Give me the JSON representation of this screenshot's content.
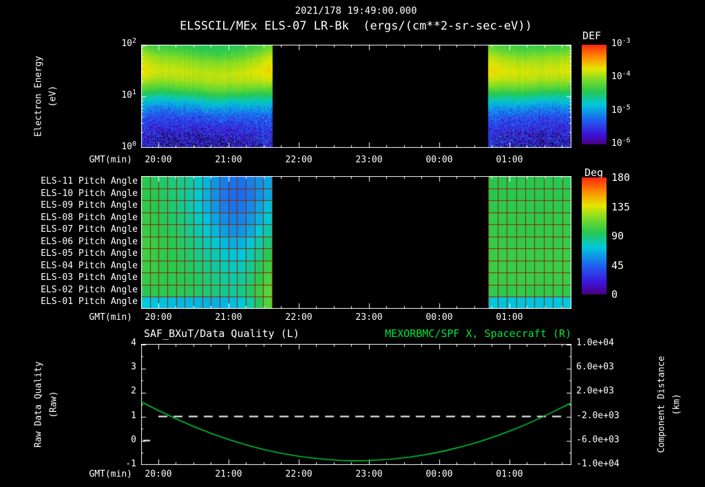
{
  "header": {
    "timestamp": "2021/178 19:49:00.000",
    "title": "ELSSCIL/MEx ELS-07 LR-Bk  (ergs/(cm**2-sr-sec-eV))"
  },
  "time_axis": {
    "label": "GMT(min)",
    "tick_labels": [
      "20:00",
      "21:00",
      "22:00",
      "23:00",
      "00:00",
      "01:00"
    ],
    "tick_minutes": [
      0,
      60,
      120,
      180,
      240,
      300
    ],
    "start_min": -14.7,
    "end_min": 353
  },
  "spectrogram_panel": {
    "ylabel": "Electron Energy",
    "ylabel_units": "(eV)",
    "ytick_base": "10",
    "ytick_exps": [
      "2",
      "1",
      "0"
    ],
    "colorbar_label": "DEF",
    "colorbar_tick_base": "10",
    "colorbar_tick_exps": [
      "-3",
      "-4",
      "-5",
      "-6"
    ]
  },
  "pitch_panel": {
    "row_labels": [
      "ELS-11 Pitch Angle",
      "ELS-10 Pitch Angle",
      "ELS-09 Pitch Angle",
      "ELS-08 Pitch Angle",
      "ELS-07 Pitch Angle",
      "ELS-06 Pitch Angle",
      "ELS-05 Pitch Angle",
      "ELS-04 Pitch Angle",
      "ELS-03 Pitch Angle",
      "ELS-02 Pitch Angle",
      "ELS-01 Pitch Angle"
    ],
    "colorbar_label": "Deg",
    "colorbar_ticks": [
      "180",
      "135",
      "90",
      "45",
      "0"
    ]
  },
  "line_panel": {
    "left_title": "SAF_BXuT/Data Quality (L)",
    "right_title": "MEXORBMC/SPF X, Spacecraft (R)",
    "left_axis_label": "Raw Data Quality",
    "left_axis_units": "(Raw)",
    "left_ticks": [
      "4",
      "3",
      "2",
      "1",
      "0",
      "-1"
    ],
    "right_axis_label": "Component Distance",
    "right_axis_units": "(km)",
    "right_ticks": [
      "1.0e+04",
      "6.0e+03",
      "2.0e+03",
      "-2.0e+03",
      "-6.0e+03",
      "-1.0e+04"
    ]
  },
  "colors": {
    "background": "#000000",
    "foreground": "#ffffff",
    "green_text": "#00e63c",
    "curve_green": "#00c838",
    "quality_line": "#ffffff",
    "grid_red": "#8a2600"
  },
  "colormap": [
    [
      0.0,
      "#4b0082"
    ],
    [
      0.1,
      "#3c14dc"
    ],
    [
      0.25,
      "#1e64f0"
    ],
    [
      0.4,
      "#00c8dc"
    ],
    [
      0.53,
      "#28c850"
    ],
    [
      0.65,
      "#7ddc28"
    ],
    [
      0.76,
      "#e6e600"
    ],
    [
      0.88,
      "#ff8c00"
    ],
    [
      1.0,
      "#ff2814"
    ]
  ],
  "chart_data": [
    {
      "type": "heatmap",
      "name": "electron-energy-spectrogram",
      "title": "ELSSCIL/MEx ELS-07 LR-Bk",
      "units": "DEF ergs/(cm**2-sr-sec-eV)",
      "ylabel": "Electron Energy (eV)",
      "y_log10_range": [
        0,
        2
      ],
      "value_log10_range": [
        -6,
        -3
      ],
      "time_segments_min": [
        [
          -14.7,
          97
        ],
        [
          282,
          353
        ]
      ],
      "reference_profile": [
        [
          0.0,
          -5.78
        ],
        [
          0.25,
          -5.7
        ],
        [
          0.5,
          -5.5
        ],
        [
          0.7,
          -5.2
        ],
        [
          0.85,
          -4.9
        ],
        [
          1.0,
          -4.55
        ],
        [
          1.15,
          -4.2
        ],
        [
          1.3,
          -3.95
        ],
        [
          1.45,
          -3.85
        ],
        [
          1.55,
          -3.92
        ],
        [
          1.7,
          -4.05
        ],
        [
          1.85,
          -4.3
        ],
        [
          2.0,
          -4.45
        ]
      ],
      "band_center_track": [
        [
          -14.7,
          1.53
        ],
        [
          10,
          1.5
        ],
        [
          30,
          1.45
        ],
        [
          50,
          1.4
        ],
        [
          70,
          1.43
        ],
        [
          90,
          1.5
        ],
        [
          97,
          1.53
        ],
        [
          282,
          1.52
        ],
        [
          310,
          1.47
        ],
        [
          330,
          1.5
        ],
        [
          353,
          1.52
        ]
      ],
      "brightness_track": [
        [
          -14.7,
          0.18
        ],
        [
          0,
          0.06
        ],
        [
          30,
          0
        ],
        [
          60,
          0.02
        ],
        [
          85,
          0.12
        ],
        [
          95,
          0.25
        ],
        [
          97,
          0.15
        ],
        [
          282,
          0.2
        ],
        [
          300,
          0.1
        ],
        [
          330,
          0.05
        ],
        [
          353,
          0.1
        ]
      ]
    },
    {
      "type": "heatmap",
      "name": "pitch-angle-panels",
      "rows_top_to_bottom": [
        "ELS-11",
        "ELS-10",
        "ELS-09",
        "ELS-08",
        "ELS-07",
        "ELS-06",
        "ELS-05",
        "ELS-04",
        "ELS-03",
        "ELS-02",
        "ELS-01"
      ],
      "units": "deg",
      "scale": [
        0,
        180
      ],
      "segments": [
        {
          "t_min": [
            -14.7,
            97
          ],
          "angles_per_row": [
            [
              95,
              95,
              92,
              90,
              88,
              85,
              80,
              72,
              62,
              55,
              50,
              48,
              50,
              55,
              60,
              65
            ],
            [
              96,
              95,
              93,
              90,
              88,
              84,
              78,
              70,
              60,
              52,
              48,
              46,
              48,
              54,
              60,
              66
            ],
            [
              98,
              96,
              94,
              92,
              88,
              84,
              78,
              70,
              62,
              55,
              50,
              48,
              52,
              58,
              66,
              72
            ],
            [
              100,
              98,
              95,
              92,
              90,
              86,
              80,
              74,
              66,
              58,
              54,
              52,
              56,
              62,
              70,
              78
            ],
            [
              100,
              98,
              96,
              94,
              92,
              88,
              82,
              76,
              70,
              64,
              58,
              56,
              60,
              68,
              76,
              84
            ],
            [
              102,
              100,
              98,
              96,
              94,
              90,
              86,
              80,
              76,
              70,
              66,
              64,
              68,
              76,
              84,
              92
            ],
            [
              102,
              100,
              98,
              96,
              94,
              92,
              88,
              84,
              80,
              76,
              72,
              70,
              74,
              82,
              90,
              98
            ],
            [
              100,
              100,
              98,
              96,
              96,
              94,
              90,
              88,
              84,
              80,
              78,
              76,
              80,
              88,
              96,
              104
            ],
            [
              98,
              98,
              98,
              96,
              96,
              94,
              92,
              90,
              88,
              84,
              82,
              80,
              84,
              92,
              100,
              108
            ],
            [
              95,
              96,
              96,
              96,
              94,
              94,
              92,
              90,
              88,
              86,
              84,
              82,
              88,
              96,
              104,
              110
            ],
            [
              72,
              72,
              70,
              70,
              68,
              68,
              68,
              66,
              66,
              66,
              68,
              70,
              76,
              86,
              100,
              112
            ]
          ]
        },
        {
          "t_min": [
            282,
            353
          ],
          "angles_per_row": [
            [
              96,
              95,
              96,
              94,
              96,
              95,
              96,
              95,
              94,
              96
            ],
            [
              95,
              96,
              94,
              96,
              95,
              94,
              96,
              95,
              96,
              95
            ],
            [
              97,
              96,
              97,
              95,
              97,
              96,
              95,
              97,
              96,
              97
            ],
            [
              98,
              97,
              98,
              96,
              98,
              97,
              96,
              98,
              97,
              98
            ],
            [
              98,
              98,
              97,
              98,
              96,
              98,
              97,
              98,
              98,
              97
            ],
            [
              99,
              98,
              99,
              97,
              99,
              98,
              97,
              99,
              98,
              99
            ],
            [
              100,
              99,
              100,
              98,
              100,
              99,
              98,
              100,
              99,
              100
            ],
            [
              100,
              100,
              99,
              100,
              98,
              100,
              99,
              100,
              100,
              99
            ],
            [
              99,
              100,
              98,
              100,
              99,
              100,
              98,
              99,
              100,
              98
            ],
            [
              97,
              98,
              96,
              98,
              97,
              96,
              98,
              97,
              98,
              96
            ],
            [
              72,
              71,
              72,
              70,
              72,
              71,
              70,
              72,
              71,
              72
            ]
          ]
        }
      ]
    },
    {
      "type": "line",
      "name": "quality-and-spacecraft-distance",
      "left_axis": {
        "label": "Raw Data Quality (Raw)",
        "range": [
          -1,
          4
        ]
      },
      "right_axis": {
        "label": "Component Distance (km)",
        "range": [
          -10000,
          10000
        ]
      },
      "series": [
        {
          "name": "SAF_BXuT/Data Quality (L)",
          "axis": "left",
          "style": "dashed",
          "points": [
            [
              0,
              1
            ],
            [
              346,
              1
            ]
          ],
          "marker": [
            [
              -13,
              0
            ],
            [
              -7,
              0
            ]
          ]
        },
        {
          "name": "MEXORBMC/SPF X, Spacecraft (R)",
          "axis": "right",
          "style": "solid",
          "points": [
            [
              -14.7,
              460
            ],
            [
              0,
              -1040
            ],
            [
              30,
              -3720
            ],
            [
              60,
              -5880
            ],
            [
              90,
              -7560
            ],
            [
              120,
              -8680
            ],
            [
              150,
              -9280
            ],
            [
              170,
              -9400
            ],
            [
              200,
              -9120
            ],
            [
              230,
              -8360
            ],
            [
              260,
              -7040
            ],
            [
              290,
              -5240
            ],
            [
              320,
              -2880
            ],
            [
              353,
              280
            ]
          ]
        }
      ]
    }
  ]
}
